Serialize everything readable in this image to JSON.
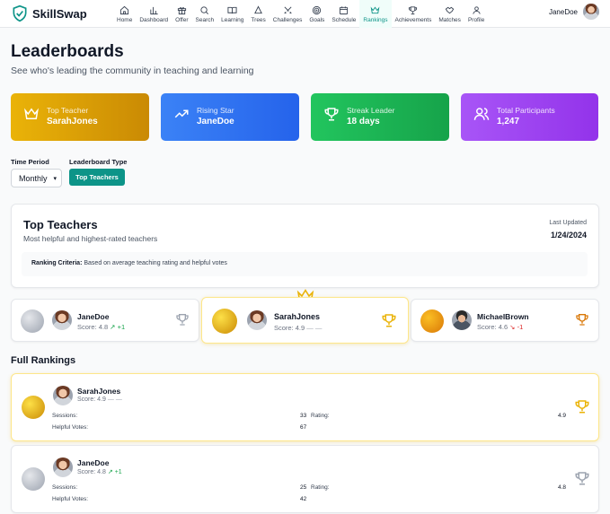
{
  "brand": {
    "name": "SkillSwap"
  },
  "nav": [
    {
      "label": "Home",
      "icon": "home-icon"
    },
    {
      "label": "Dashboard",
      "icon": "bar-chart-icon"
    },
    {
      "label": "Offer",
      "icon": "gift-icon"
    },
    {
      "label": "Search",
      "icon": "search-icon"
    },
    {
      "label": "Learning",
      "icon": "book-icon"
    },
    {
      "label": "Trees",
      "icon": "tree-icon"
    },
    {
      "label": "Challenges",
      "icon": "swords-icon"
    },
    {
      "label": "Goals",
      "icon": "target-icon"
    },
    {
      "label": "Schedule",
      "icon": "calendar-icon"
    },
    {
      "label": "Rankings",
      "icon": "crown-icon",
      "active": true
    },
    {
      "label": "Achievements",
      "icon": "trophy-icon"
    },
    {
      "label": "Matches",
      "icon": "handshake-icon"
    },
    {
      "label": "Profile",
      "icon": "user-icon"
    }
  ],
  "user": {
    "name": "JaneDoe"
  },
  "page": {
    "title": "Leaderboards",
    "subtitle": "See who's leading the community in teaching and learning"
  },
  "stats": [
    {
      "label": "Top Teacher",
      "value": "SarahJones",
      "icon": "crown-icon"
    },
    {
      "label": "Rising Star",
      "value": "JaneDoe",
      "icon": "trending-up-icon"
    },
    {
      "label": "Streak Leader",
      "value": "18 days",
      "icon": "trophy-icon"
    },
    {
      "label": "Total Participants",
      "value": "1,247",
      "icon": "users-icon"
    }
  ],
  "filters": {
    "period_label": "Time Period",
    "period_value": "Monthly",
    "type_label": "Leaderboard Type",
    "type_value": "Top Teachers"
  },
  "top_panel": {
    "title": "Top Teachers",
    "description": "Most helpful and highest-rated teachers",
    "last_updated_label": "Last Updated",
    "last_updated_value": "1/24/2024",
    "criteria_label": "Ranking Criteria:",
    "criteria_text": "Based on average teaching rating and helpful votes"
  },
  "podium": [
    {
      "name": "JaneDoe",
      "score": "Score: 4.8",
      "change": "+1",
      "trend": "up"
    },
    {
      "name": "SarahJones",
      "score": "Score: 4.9",
      "change": "—",
      "trend": "flat"
    },
    {
      "name": "MichaelBrown",
      "score": "Score: 4.6",
      "change": "-1",
      "trend": "down"
    }
  ],
  "full_rankings": {
    "title": "Full Rankings",
    "rows": [
      {
        "name": "SarahJones",
        "score": "Score: 4.9",
        "change": "—",
        "trend": "flat",
        "sessions_label": "Sessions:",
        "sessions": "33",
        "rating_label": "Rating:",
        "rating": "4.9",
        "helpful_label": "Helpful Votes:",
        "helpful": "67"
      },
      {
        "name": "JaneDoe",
        "score": "Score: 4.8",
        "change": "+1",
        "trend": "up",
        "sessions_label": "Sessions:",
        "sessions": "25",
        "rating_label": "Rating:",
        "rating": "4.8",
        "helpful_label": "Helpful Votes:",
        "helpful": "42"
      }
    ]
  },
  "colors": {
    "accent": "#0d9488",
    "gold": "#eab308",
    "blue": "#3b82f6",
    "green": "#22c55e",
    "purple": "#a855f7"
  }
}
